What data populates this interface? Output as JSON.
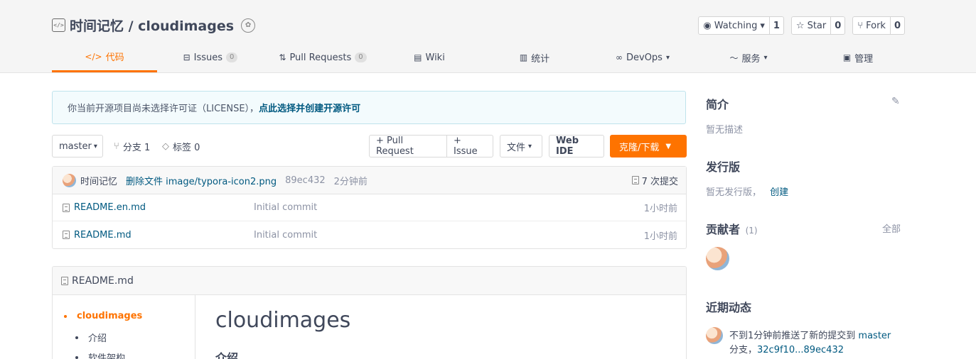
{
  "repo": {
    "title": "时间记忆 / cloudimages",
    "watch": {
      "label": "Watching",
      "count": "1"
    },
    "star": {
      "label": "Star",
      "count": "0"
    },
    "fork": {
      "label": "Fork",
      "count": "0"
    }
  },
  "tabs": [
    {
      "label": "代码",
      "icon": "code-icon",
      "badge": null
    },
    {
      "label": "Issues",
      "icon": "issues-icon",
      "badge": "0"
    },
    {
      "label": "Pull Requests",
      "icon": "pull-request-icon",
      "badge": "0"
    },
    {
      "label": "Wiki",
      "icon": "wiki-icon",
      "badge": null
    },
    {
      "label": "统计",
      "icon": "stats-icon",
      "badge": null
    },
    {
      "label": "DevOps",
      "icon": "devops-icon",
      "badge": null
    },
    {
      "label": "服务",
      "icon": "service-icon",
      "badge": null
    },
    {
      "label": "管理",
      "icon": "manage-icon",
      "badge": null
    }
  ],
  "notice": {
    "text": "你当前开源项目尚未选择许可证（LICENSE），",
    "link": "点此选择并创建开源许可"
  },
  "toolbar": {
    "branch": "master",
    "branches": "分支 1",
    "tags": "标签 0",
    "pull_request": "+ Pull Request",
    "issue": "+ Issue",
    "file": "文件",
    "web_ide": "Web IDE",
    "clone": "克隆/下载"
  },
  "commit": {
    "author": "时间记忆",
    "message": "删除文件 image/typora-icon2.png",
    "sha": "89ec432",
    "time": "2分钟前",
    "total": "7 次提交"
  },
  "files": [
    {
      "name": "README.en.md",
      "message": "Initial commit",
      "time": "1小时前"
    },
    {
      "name": "README.md",
      "message": "Initial commit",
      "time": "1小时前"
    }
  ],
  "readme": {
    "title": "README.md",
    "toc": [
      "cloudimages",
      "介绍",
      "软件架构"
    ],
    "h1": "cloudimages",
    "h2": "介绍"
  },
  "sidebar": {
    "intro_title": "简介",
    "intro_text": "暂无描述",
    "release_title": "发行版",
    "release_text": "暂无发行版，",
    "release_link": "创建",
    "contributors_title": "贡献者",
    "contributors_count": "(1)",
    "contributors_all": "全部",
    "activity_title": "近期动态",
    "activity_text": "不到1分钟前推送了新的提交到",
    "activity_branch": "master",
    "activity_text2": "分支，",
    "activity_range": "32c9f10...89ec432"
  },
  "colors": {
    "accent": "#fe7300",
    "link": "#005980"
  }
}
